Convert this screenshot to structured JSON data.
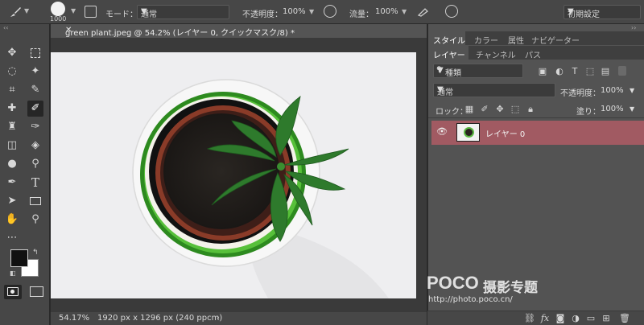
{
  "options_bar": {
    "brush_size": "1000",
    "mode_label": "モード：",
    "mode_value": "通常",
    "opacity_label": "不透明度：",
    "opacity_value": "100%",
    "flow_label": "流量：",
    "flow_value": "100%",
    "workspace": "初期設定"
  },
  "document": {
    "tab_title": "green plant.jpeg @ 54.2% (レイヤー 0, クイックマスク/8) *",
    "zoom": "54.17%",
    "dimensions": "1920 px x 1296 px (240 ppcm)"
  },
  "panels": {
    "top_tabs": [
      "スタイル",
      "カラー",
      "属性",
      "ナビゲーター"
    ],
    "layer_tabs": [
      "レイヤー",
      "チャンネル",
      "パス"
    ],
    "filter_kind": "種類",
    "blend_mode": "通常",
    "opacity_label": "不透明度：",
    "opacity_value": "100%",
    "lock_label": "ロック：",
    "fill_label": "塗り：",
    "fill_value": "100%",
    "layer_name": "レイヤー 0"
  },
  "watermark": {
    "brand": "POCO",
    "title": "摄影专题",
    "url": "http://photo.poco.cn/"
  },
  "colors": {
    "selected_layer": "#a15a62",
    "foreground": "#111111",
    "background": "#ffffff"
  }
}
